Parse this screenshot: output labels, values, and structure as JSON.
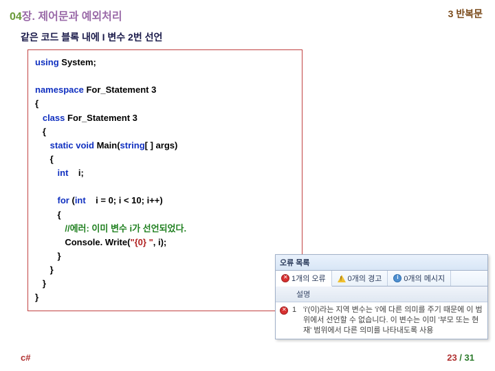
{
  "header": {
    "chapter_num": "04",
    "chapter_label": "장. 제어문과 예외처리",
    "section": "3 반복문"
  },
  "subtitle": "같은 코드 블록 내에 I 변수 2번 선언",
  "code": {
    "l1_kw": "using",
    "l1_txt": " System;",
    "l2_kw": "namespace",
    "l2_txt": " For_Statement 3",
    "l3": "{",
    "l4_pre": "   ",
    "l4_kw": "class",
    "l4_txt": " For_Statement 3",
    "l5": "   {",
    "l6_pre": "      ",
    "l6_kw": "static void",
    "l6_txt": " Main(",
    "l6_kw2": "string",
    "l6_txt2": "[ ] args)",
    "l7": "      {",
    "l8_pre": "         ",
    "l8_kw": "int",
    "l8_txt": "    i;",
    "l9_pre": "         ",
    "l9_kw": "for",
    "l9_txt": " (",
    "l9_kw2": "int",
    "l9_txt2": "    i = 0; i < 10; i++)",
    "l10": "         {",
    "l11_pre": "            ",
    "l11_cm": "//에러: 이미 변수 i가 선언되었다.",
    "l12_pre": "            Console. Write(",
    "l12_st": "\"{0} \"",
    "l12_txt": ", i);",
    "l13": "         }",
    "l14": "      }",
    "l15": "   }",
    "l16": "}"
  },
  "error_panel": {
    "title": "오류 목록",
    "tabs": {
      "errors": "1개의 오류",
      "warnings": "0개의 경고",
      "messages": "0개의 메시지"
    },
    "col_desc": "설명",
    "row1_num": "1",
    "row1_msg": "'i'(이)라는 지역 변수는 'i'에 다른 의미를 주기 때문에 이 범위에서 선언할 수 없습니다. 이 변수는 이미 '부모 또는 현재' 범위에서 다른 의미를 나타내도록 사용"
  },
  "footer": {
    "lang": "c#",
    "page_cur": "23",
    "page_sep": " / ",
    "page_total": "31"
  }
}
